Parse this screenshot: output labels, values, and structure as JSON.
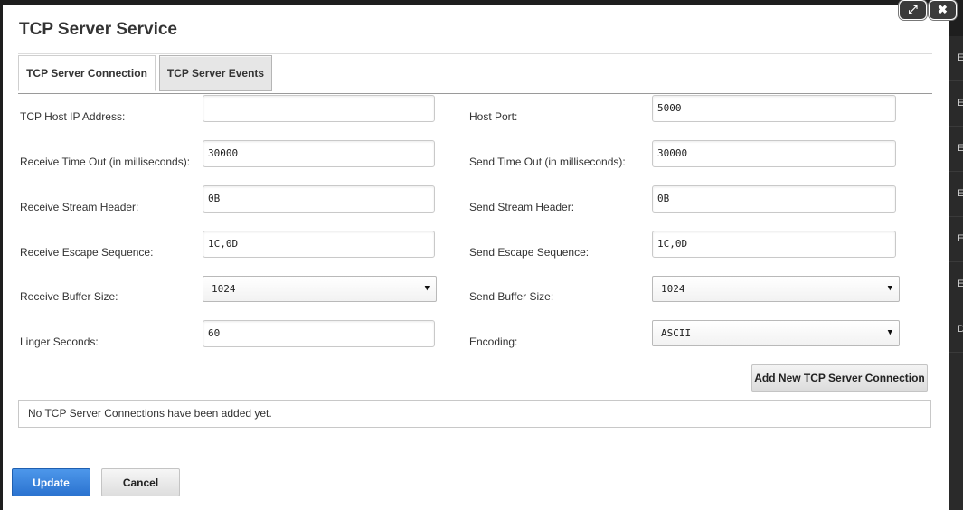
{
  "modal": {
    "title": "TCP Server Service",
    "controls": {
      "expand_icon": "⤢",
      "close_icon": "✖"
    }
  },
  "tabs": [
    {
      "label": "TCP Server Connection",
      "active": true
    },
    {
      "label": "TCP Server Events",
      "active": false
    }
  ],
  "form": {
    "tcp_host_ip": {
      "label": "TCP Host IP Address:",
      "value": ""
    },
    "host_port": {
      "label": "Host Port:",
      "value": "5000"
    },
    "receive_timeout": {
      "label": "Receive Time Out (in milliseconds):",
      "value": "30000"
    },
    "send_timeout": {
      "label": "Send Time Out (in milliseconds):",
      "value": "30000"
    },
    "receive_stream_header": {
      "label": "Receive Stream Header:",
      "value": "0B"
    },
    "send_stream_header": {
      "label": "Send Stream Header:",
      "value": "0B"
    },
    "receive_escape_sequence": {
      "label": "Receive Escape Sequence:",
      "value": "1C,0D"
    },
    "send_escape_sequence": {
      "label": "Send Escape Sequence:",
      "value": "1C,0D"
    },
    "receive_buffer_size": {
      "label": "Receive Buffer Size:",
      "selected": "1024"
    },
    "send_buffer_size": {
      "label": "Send Buffer Size:",
      "selected": "1024"
    },
    "linger_seconds": {
      "label": "Linger Seconds:",
      "value": "60"
    },
    "encoding": {
      "label": "Encoding:",
      "selected": "ASCII"
    },
    "caret_icon": "▼"
  },
  "add_button_label": "Add New TCP Server Connection",
  "empty_message": "No TCP Server Connections have been added yet.",
  "footer": {
    "update_label": "Update",
    "cancel_label": "Cancel"
  },
  "background": {
    "row_letters": [
      "E",
      "E",
      "E",
      "E",
      "E",
      "E",
      "D"
    ]
  },
  "colors": {
    "primary": "#2b73d0",
    "overlay": "#1e1e1e"
  }
}
